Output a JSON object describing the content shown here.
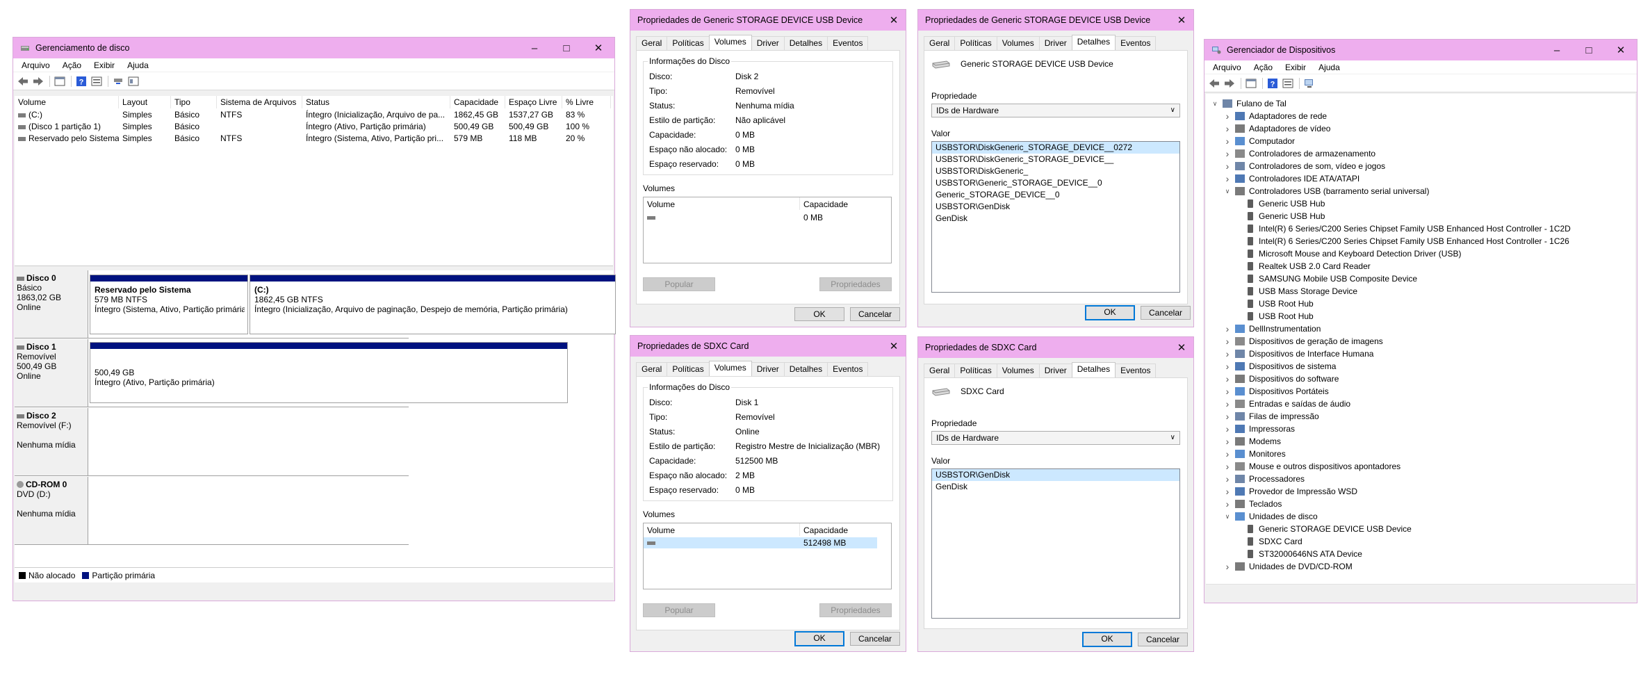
{
  "disk_mgmt": {
    "title": "Gerenciamento de disco",
    "menu": [
      "Arquivo",
      "Ação",
      "Exibir",
      "Ajuda"
    ],
    "columns": [
      "Volume",
      "Layout",
      "Tipo",
      "Sistema de Arquivos",
      "Status",
      "Capacidade",
      "Espaço Livre",
      "% Livre"
    ],
    "rows": [
      [
        "(C:)",
        "Simples",
        "Básico",
        "NTFS",
        "Íntegro (Inicialização, Arquivo de pa...",
        "1862,45 GB",
        "1537,27 GB",
        "83 %"
      ],
      [
        "(Disco 1 partição 1)",
        "Simples",
        "Básico",
        "",
        "Íntegro (Ativo, Partição primária)",
        "500,49 GB",
        "500,49 GB",
        "100 %"
      ],
      [
        "Reservado pelo Sistema",
        "Simples",
        "Básico",
        "NTFS",
        "Íntegro (Sistema, Ativo, Partição pri...",
        "579 MB",
        "118 MB",
        "20 %"
      ]
    ],
    "disks": {
      "d0": {
        "name": "Disco 0",
        "l1": "Básico",
        "l2": "1863,02 GB",
        "l3": "Online"
      },
      "d1": {
        "name": "Disco 1",
        "l1": "Removível",
        "l2": "500,49 GB",
        "l3": "Online"
      },
      "d2": {
        "name": "Disco 2",
        "l1": "Removível (F:)",
        "l3": "Nenhuma mídia"
      },
      "cd": {
        "name": "CD-ROM 0",
        "l1": "DVD (D:)",
        "l3": "Nenhuma mídia"
      }
    },
    "parts": {
      "p0a": {
        "title": "Reservado pelo Sistema",
        "size": "579 MB NTFS",
        "status": "Íntegro (Sistema, Ativo, Partição primária)"
      },
      "p0b": {
        "title": "(C:)",
        "size": "1862,45 GB NTFS",
        "status": "Íntegro (Inicialização, Arquivo de paginação, Despejo de memória, Partição primária)"
      },
      "p1a": {
        "size": "500,49 GB",
        "status": "Íntegro (Ativo, Partição primária)"
      }
    },
    "legend": {
      "unalloc": "Não alocado",
      "primary": "Partição primária"
    }
  },
  "tabs_list": [
    "Geral",
    "Políticas",
    "Volumes",
    "Driver",
    "Detalhes",
    "Eventos"
  ],
  "vol_common": {
    "info_title": "Informações do Disco",
    "labels": [
      "Disco:",
      "Tipo:",
      "Status:",
      "Estilo de partição:",
      "Capacidade:",
      "Espaço não alocado:",
      "Espaço reservado:"
    ],
    "volumes_title": "Volumes",
    "col_volume": "Volume",
    "col_capacity": "Capacidade",
    "populate": "Popular",
    "properties": "Propriedades",
    "ok": "OK",
    "cancel": "Cancelar"
  },
  "det_common": {
    "prop_label": "Propriedade",
    "value_label": "Valor",
    "ok": "OK",
    "cancel": "Cancelar"
  },
  "dlg_usb_vol": {
    "title": "Propriedades de Generic STORAGE DEVICE USB Device",
    "values": [
      "Disk 2",
      "Removível",
      "Nenhuma mídia",
      "Não aplicável",
      "0 MB",
      "0 MB",
      "0 MB"
    ],
    "vol_capacity": "0 MB"
  },
  "dlg_usb_det": {
    "title": "Propriedades de Generic STORAGE DEVICE USB Device",
    "device": "Generic STORAGE DEVICE USB Device",
    "property": "IDs de Hardware",
    "values": [
      "USBSTOR\\DiskGeneric_STORAGE_DEVICE__0272",
      "USBSTOR\\DiskGeneric_STORAGE_DEVICE__",
      "USBSTOR\\DiskGeneric_",
      "USBSTOR\\Generic_STORAGE_DEVICE__0",
      "Generic_STORAGE_DEVICE__0",
      "USBSTOR\\GenDisk",
      "GenDisk"
    ]
  },
  "dlg_sd_vol": {
    "title": "Propriedades de SDXC Card",
    "values": [
      "Disk 1",
      "Removível",
      "Online",
      "Registro Mestre de Inicialização (MBR)",
      "512500 MB",
      "2 MB",
      "0 MB"
    ],
    "vol_capacity": "512498 MB"
  },
  "dlg_sd_det": {
    "title": "Propriedades de SDXC Card",
    "device": "SDXC Card",
    "property": "IDs de Hardware",
    "values": [
      "USBSTOR\\GenDisk",
      "GenDisk"
    ]
  },
  "devmgr": {
    "title": "Gerenciador de Dispositivos",
    "menu": [
      "Arquivo",
      "Ação",
      "Exibir",
      "Ajuda"
    ],
    "tree": [
      {
        "label": "Fulano  de Tal",
        "level": 0,
        "exp": "open"
      },
      {
        "label": "Adaptadores de rede",
        "level": 1,
        "exp": "closed"
      },
      {
        "label": "Adaptadores de vídeo",
        "level": 1,
        "exp": "closed"
      },
      {
        "label": "Computador",
        "level": 1,
        "exp": "closed"
      },
      {
        "label": "Controladores de armazenamento",
        "level": 1,
        "exp": "closed"
      },
      {
        "label": "Controladores de som, vídeo e jogos",
        "level": 1,
        "exp": "closed"
      },
      {
        "label": "Controladores IDE ATA/ATAPI",
        "level": 1,
        "exp": "closed"
      },
      {
        "label": "Controladores USB (barramento serial universal)",
        "level": 1,
        "exp": "open"
      },
      {
        "label": "Generic USB Hub",
        "level": 2,
        "exp": "none"
      },
      {
        "label": "Generic USB Hub",
        "level": 2,
        "exp": "none"
      },
      {
        "label": "Intel(R) 6 Series/C200 Series Chipset Family USB Enhanced Host Controller - 1C2D",
        "level": 2,
        "exp": "none"
      },
      {
        "label": "Intel(R) 6 Series/C200 Series Chipset Family USB Enhanced Host Controller - 1C26",
        "level": 2,
        "exp": "none"
      },
      {
        "label": "Microsoft Mouse and Keyboard Detection Driver (USB)",
        "level": 2,
        "exp": "none"
      },
      {
        "label": "Realtek USB 2.0 Card Reader",
        "level": 2,
        "exp": "none"
      },
      {
        "label": "SAMSUNG Mobile USB Composite Device",
        "level": 2,
        "exp": "none"
      },
      {
        "label": "USB Mass Storage Device",
        "level": 2,
        "exp": "none"
      },
      {
        "label": "USB Root Hub",
        "level": 2,
        "exp": "none"
      },
      {
        "label": "USB Root Hub",
        "level": 2,
        "exp": "none"
      },
      {
        "label": "DellInstrumentation",
        "level": 1,
        "exp": "closed"
      },
      {
        "label": "Dispositivos de geração de imagens",
        "level": 1,
        "exp": "closed"
      },
      {
        "label": "Dispositivos de Interface Humana",
        "level": 1,
        "exp": "closed"
      },
      {
        "label": "Dispositivos de sistema",
        "level": 1,
        "exp": "closed"
      },
      {
        "label": "Dispositivos do software",
        "level": 1,
        "exp": "closed"
      },
      {
        "label": "Dispositivos Portáteis",
        "level": 1,
        "exp": "closed"
      },
      {
        "label": "Entradas e saídas de áudio",
        "level": 1,
        "exp": "closed"
      },
      {
        "label": "Filas de impressão",
        "level": 1,
        "exp": "closed"
      },
      {
        "label": "Impressoras",
        "level": 1,
        "exp": "closed"
      },
      {
        "label": "Modems",
        "level": 1,
        "exp": "closed"
      },
      {
        "label": "Monitores",
        "level": 1,
        "exp": "closed"
      },
      {
        "label": "Mouse e outros dispositivos apontadores",
        "level": 1,
        "exp": "closed"
      },
      {
        "label": "Processadores",
        "level": 1,
        "exp": "closed"
      },
      {
        "label": "Provedor de Impressão WSD",
        "level": 1,
        "exp": "closed"
      },
      {
        "label": "Teclados",
        "level": 1,
        "exp": "closed"
      },
      {
        "label": "Unidades de disco",
        "level": 1,
        "exp": "open"
      },
      {
        "label": "Generic STORAGE DEVICE USB Device",
        "level": 2,
        "exp": "none"
      },
      {
        "label": "SDXC Card",
        "level": 2,
        "exp": "none"
      },
      {
        "label": "ST32000646NS ATA Device",
        "level": 2,
        "exp": "none"
      },
      {
        "label": "Unidades de DVD/CD-ROM",
        "level": 1,
        "exp": "closed"
      }
    ]
  }
}
